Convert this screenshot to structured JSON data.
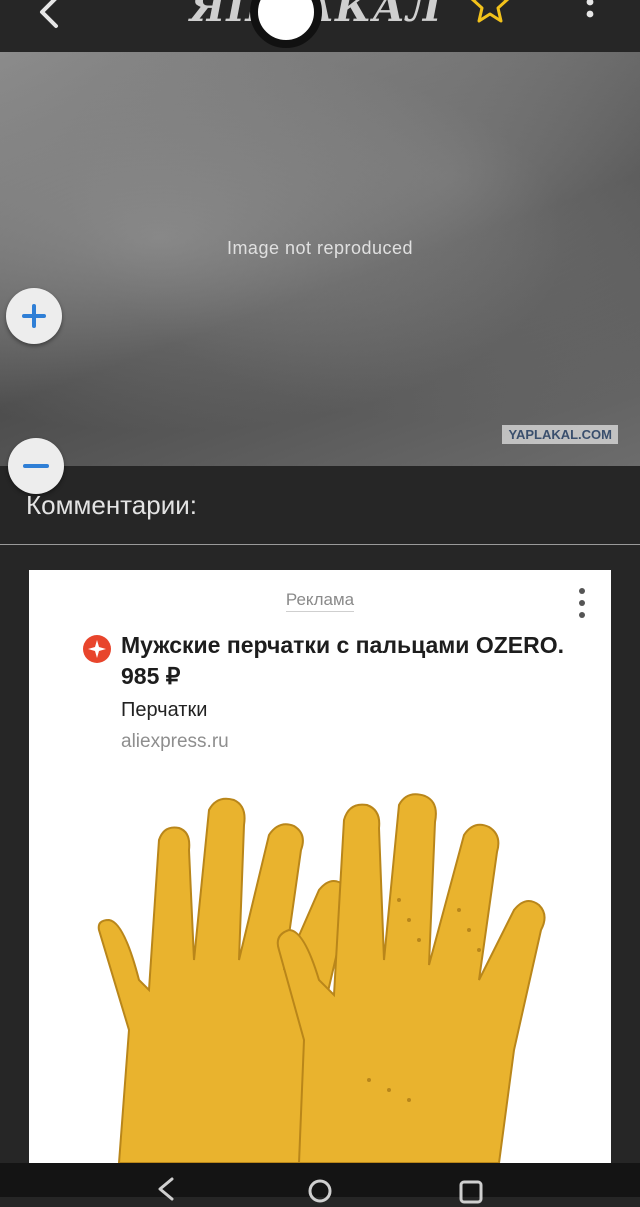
{
  "header": {
    "logo_text": "ЯПЛАКАЛ",
    "icons": [
      "back-arrow-icon",
      "logo-emblem-icon",
      "favorite-star-icon",
      "more-vertical-icon"
    ],
    "star_color": "#f2c21b"
  },
  "post": {
    "content_note": "Image not reproduced",
    "watermark": "YAPLAKAL.COM",
    "zoom_in_label": "+",
    "zoom_out_label": "−",
    "zoom_color": "#2f7fd6"
  },
  "comments": {
    "title": "Комментарии:"
  },
  "ad": {
    "label": "Реклама",
    "title": "Мужские перчатки с пальцами OZERO. 985 ₽",
    "subtitle": "Перчатки",
    "domain": "aliexpress.ru",
    "brand_color": "#e8452c",
    "product_color": "#e9b32e"
  },
  "navbar": {
    "icons": [
      "nav-back-icon",
      "nav-home-icon",
      "nav-recents-icon"
    ]
  }
}
